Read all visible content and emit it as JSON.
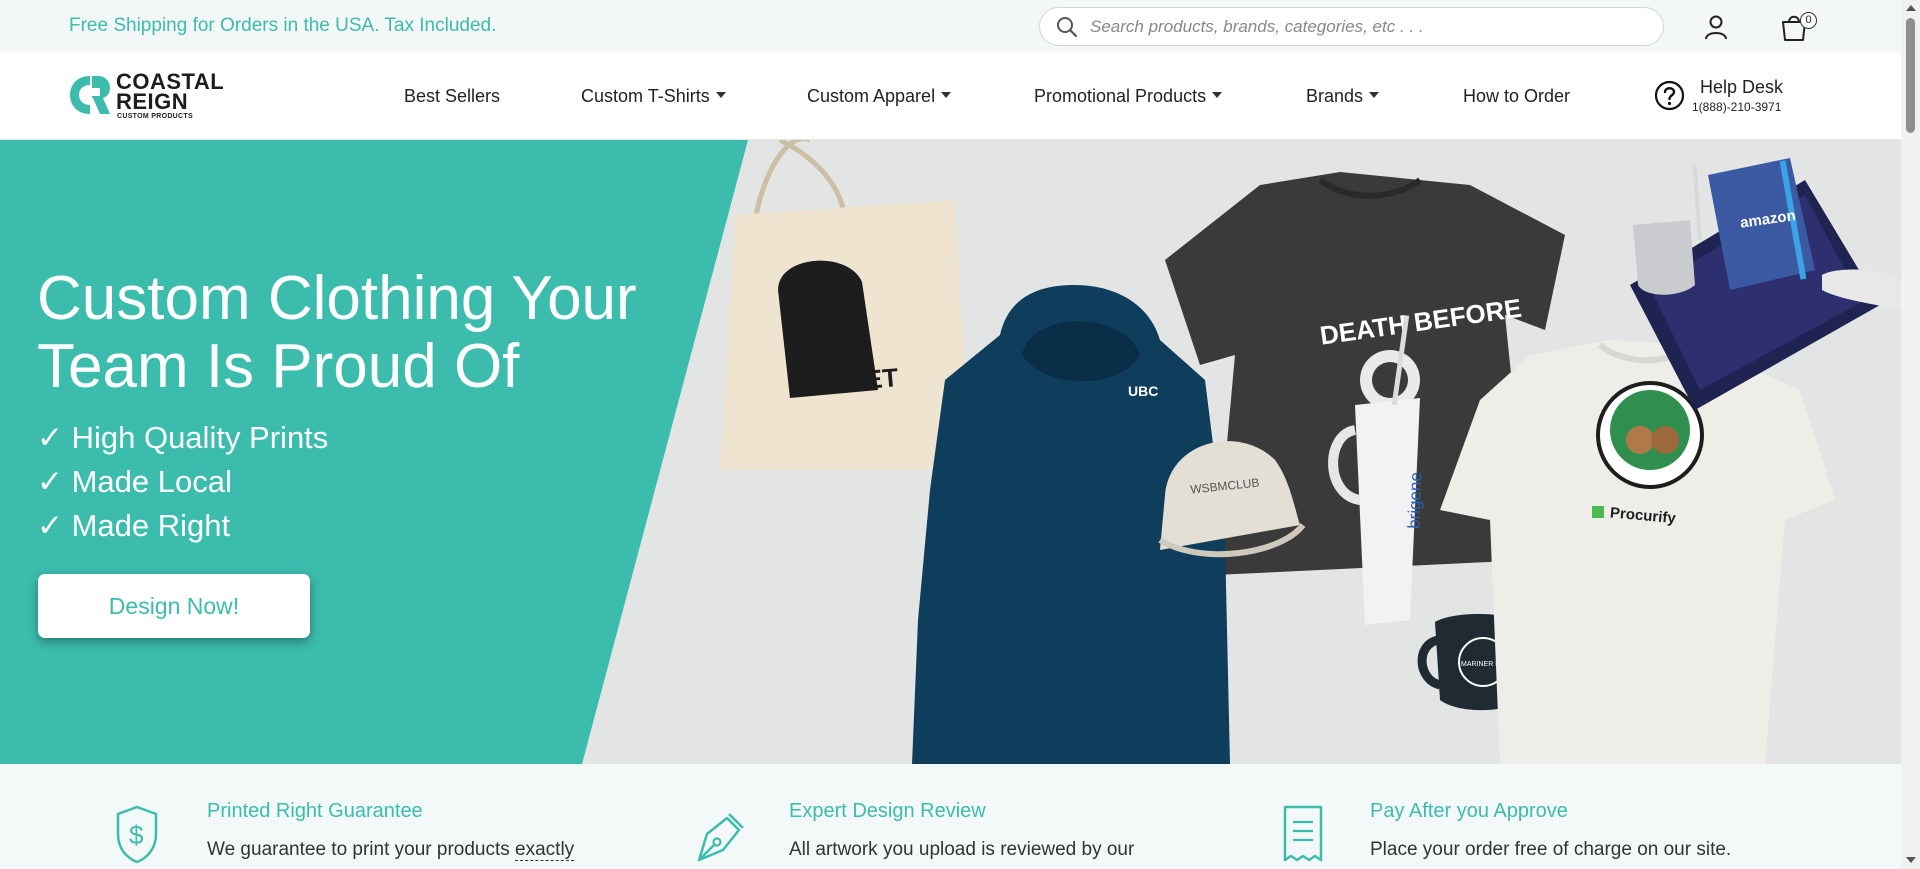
{
  "topbar": {
    "promo": "Free Shipping for Orders in the USA. Tax Included.",
    "search_placeholder": "Search products, brands, categories, etc . . .",
    "cart_count": "0"
  },
  "logo": {
    "line1": "COASTAL",
    "line2": "REIGN",
    "line3": "CUSTOM PRODUCTS"
  },
  "nav": {
    "items": [
      {
        "label": "Best Sellers",
        "has_dropdown": false
      },
      {
        "label": "Custom T-Shirts",
        "has_dropdown": true
      },
      {
        "label": "Custom Apparel",
        "has_dropdown": true
      },
      {
        "label": "Promotional Products",
        "has_dropdown": true
      },
      {
        "label": "Brands",
        "has_dropdown": true
      },
      {
        "label": "How to Order",
        "has_dropdown": false
      }
    ],
    "help_title": "Help Desk",
    "help_phone": "1(888)-210-3971"
  },
  "hero": {
    "title_line1": "Custom Clothing Your",
    "title_line2": "Team Is Proud Of",
    "checks": [
      "✓ High Quality Prints",
      "✓ Made Local",
      "✓ Made Right"
    ],
    "cta": "Design Now!",
    "product_texts": {
      "tote": "PALLET",
      "hoodie": "UBC",
      "tshirt_dark": "DEATH BEFORE",
      "cap": "WSBMCLUB",
      "tumbler": "brigene",
      "mug": "MARINER BREWING",
      "tshirt_light": "Procurify",
      "box": "amazon"
    }
  },
  "features": [
    {
      "title": "Printed Right Guarantee",
      "desc_plain": "We guarantee to print your products ",
      "desc_link": "exactly",
      "icon": "shield-dollar-icon"
    },
    {
      "title": "Expert Design Review",
      "desc_plain": "All artwork you upload is reviewed by our",
      "desc_link": "",
      "icon": "pen-nib-icon"
    },
    {
      "title": "Pay After you Approve",
      "desc_plain": "Place your order free of charge on our site.",
      "desc_link": "",
      "icon": "receipt-icon"
    }
  ],
  "colors": {
    "accent": "#3bbcad",
    "hero_bg": "#e3e4e4",
    "feature_bg": "#f3f9f9",
    "hoodie": "#0f3d5c",
    "dark_tee": "#3a3a3b"
  }
}
